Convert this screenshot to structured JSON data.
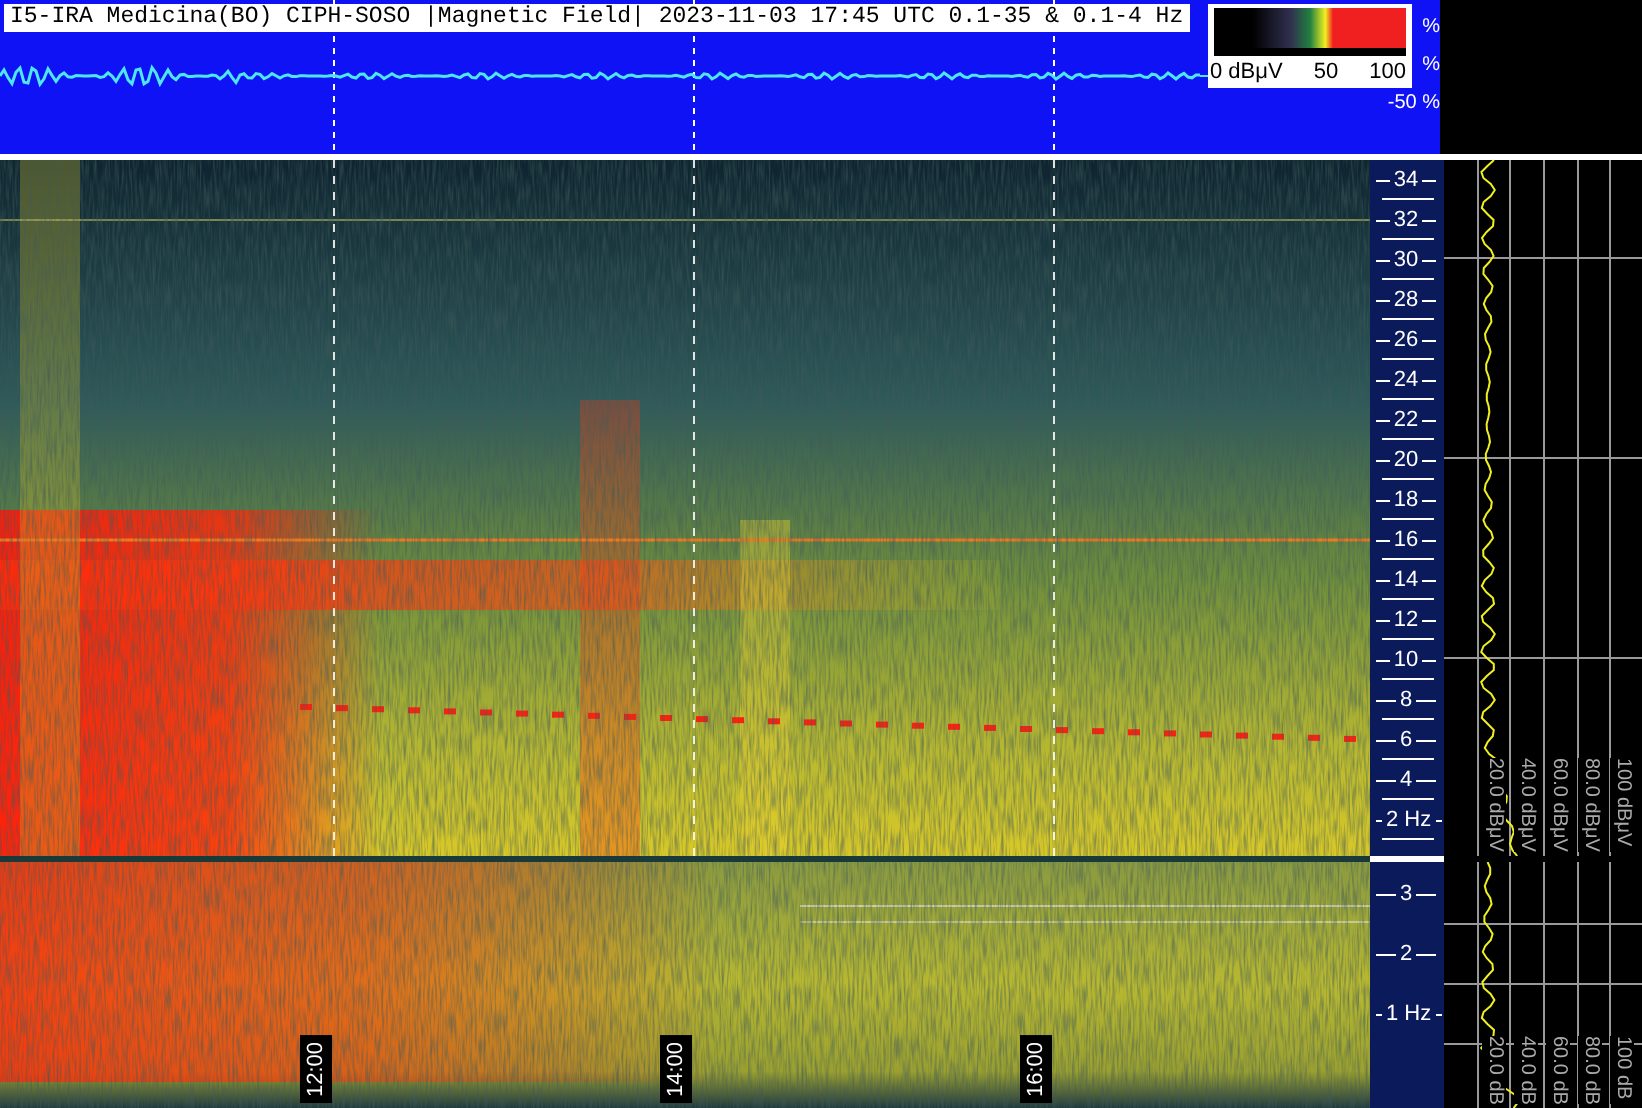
{
  "title": "I5-IRA Medicina(BO) CIPH-SOSO |Magnetic Field| 2023-11-03 17:45 UTC 0.1-35 & 0.1-4 Hz",
  "legend": {
    "scale_labels": [
      "0 dBμV",
      "50",
      "100"
    ],
    "percent_marks": [
      "%",
      "%",
      "-50 %"
    ]
  },
  "spectrogram_upper": {
    "freq_ticks": [
      "34",
      "32",
      "30",
      "28",
      "26",
      "24",
      "22",
      "20",
      "18",
      "16",
      "14",
      "12",
      "10",
      "8",
      "6",
      "4",
      "2 Hz"
    ],
    "level_labels": [
      "20.0 dBμV",
      "40.0 dBμV",
      "60.0 dBμV",
      "80.0 dBμV",
      "100 dBμV"
    ]
  },
  "spectrogram_lower": {
    "freq_ticks": [
      "3",
      "2",
      "1 Hz"
    ],
    "level_labels": [
      "20.0 dB",
      "40.0 dB",
      "60.0 dB",
      "80.0 dB",
      "100 dB"
    ]
  },
  "time_labels": [
    "12:00",
    "14:00",
    "16:00"
  ]
}
